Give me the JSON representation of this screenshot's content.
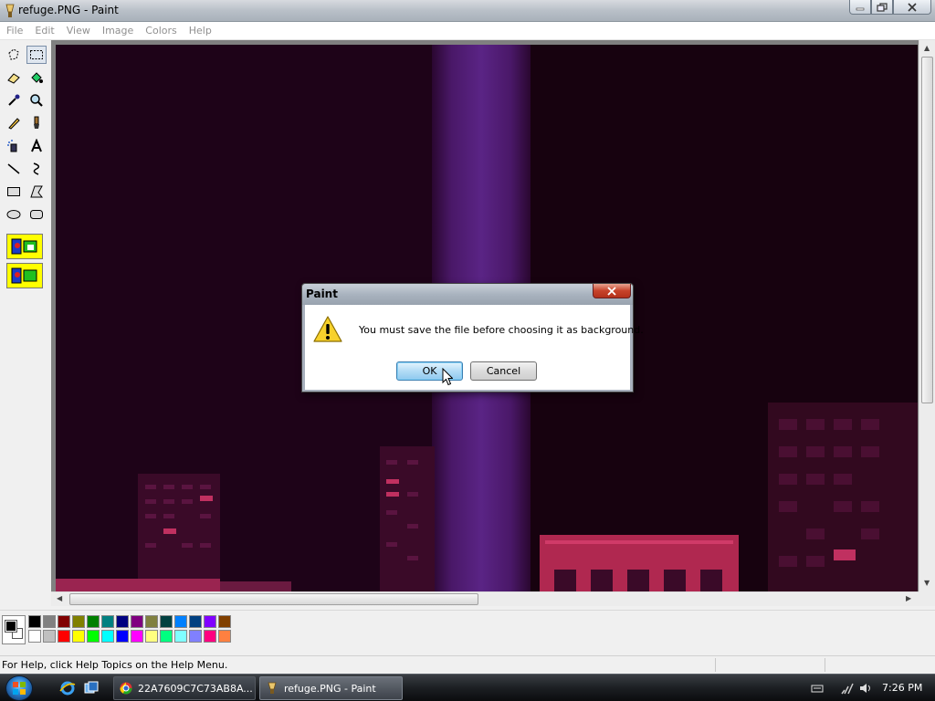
{
  "window": {
    "title": "refuge.PNG - Paint"
  },
  "menu": {
    "items": [
      "File",
      "Edit",
      "View",
      "Image",
      "Colors",
      "Help"
    ]
  },
  "toolbox": {
    "tools": [
      "free-form-select",
      "select",
      "eraser",
      "fill-with-color",
      "pick-color",
      "magnifier",
      "pencil",
      "brush",
      "airbrush",
      "text",
      "line",
      "curve",
      "rectangle",
      "polygon",
      "ellipse",
      "rounded-rectangle"
    ],
    "active_tool": "select",
    "options": [
      "opaque-selection",
      "transparent-selection"
    ]
  },
  "palette": {
    "foreground": "#000000",
    "background": "#ffffff",
    "colors_row1": [
      "#000000",
      "#808080",
      "#800000",
      "#808000",
      "#008000",
      "#008080",
      "#000080",
      "#800080",
      "#808040",
      "#004040",
      "#0080ff",
      "#004080",
      "#8000ff",
      "#804000"
    ],
    "colors_row2": [
      "#ffffff",
      "#c0c0c0",
      "#ff0000",
      "#ffff00",
      "#00ff00",
      "#00ffff",
      "#0000ff",
      "#ff00ff",
      "#ffff80",
      "#00ff80",
      "#80ffff",
      "#8080ff",
      "#ff0080",
      "#ff8040"
    ]
  },
  "status": {
    "text": "For Help, click Help Topics on the Help Menu."
  },
  "dialog": {
    "title": "Paint",
    "icon": "warning-icon",
    "message": "You must save the file before choosing it as background.",
    "ok_label": "OK",
    "cancel_label": "Cancel"
  },
  "taskbar": {
    "tasks": [
      {
        "label": "22A7609C7C73AB8A...",
        "icon": "chrome-icon",
        "active": false
      },
      {
        "label": "refuge.PNG - Paint",
        "icon": "paint-icon",
        "active": true
      }
    ],
    "clock": "7:26 PM"
  },
  "colors": {
    "canvas_bg": "#1e0318",
    "beam": "#5a1e7a",
    "building": "#c0305a",
    "ok_accent": "#8ec8ee"
  }
}
